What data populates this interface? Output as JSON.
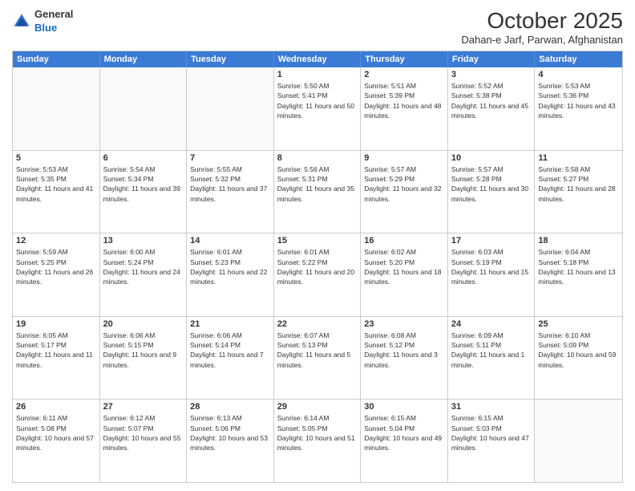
{
  "header": {
    "logo": {
      "general": "General",
      "blue": "Blue"
    },
    "month": "October 2025",
    "location": "Dahan-e Jarf, Parwan, Afghanistan"
  },
  "day_headers": [
    "Sunday",
    "Monday",
    "Tuesday",
    "Wednesday",
    "Thursday",
    "Friday",
    "Saturday"
  ],
  "weeks": [
    [
      {
        "day": "",
        "empty": true
      },
      {
        "day": "",
        "empty": true
      },
      {
        "day": "",
        "empty": true
      },
      {
        "day": "1",
        "sunrise": "Sunrise: 5:50 AM",
        "sunset": "Sunset: 5:41 PM",
        "daylight": "Daylight: 11 hours and 50 minutes."
      },
      {
        "day": "2",
        "sunrise": "Sunrise: 5:51 AM",
        "sunset": "Sunset: 5:39 PM",
        "daylight": "Daylight: 11 hours and 48 minutes."
      },
      {
        "day": "3",
        "sunrise": "Sunrise: 5:52 AM",
        "sunset": "Sunset: 5:38 PM",
        "daylight": "Daylight: 11 hours and 45 minutes."
      },
      {
        "day": "4",
        "sunrise": "Sunrise: 5:53 AM",
        "sunset": "Sunset: 5:36 PM",
        "daylight": "Daylight: 11 hours and 43 minutes."
      }
    ],
    [
      {
        "day": "5",
        "sunrise": "Sunrise: 5:53 AM",
        "sunset": "Sunset: 5:35 PM",
        "daylight": "Daylight: 11 hours and 41 minutes."
      },
      {
        "day": "6",
        "sunrise": "Sunrise: 5:54 AM",
        "sunset": "Sunset: 5:34 PM",
        "daylight": "Daylight: 11 hours and 39 minutes."
      },
      {
        "day": "7",
        "sunrise": "Sunrise: 5:55 AM",
        "sunset": "Sunset: 5:32 PM",
        "daylight": "Daylight: 11 hours and 37 minutes."
      },
      {
        "day": "8",
        "sunrise": "Sunrise: 5:56 AM",
        "sunset": "Sunset: 5:31 PM",
        "daylight": "Daylight: 11 hours and 35 minutes."
      },
      {
        "day": "9",
        "sunrise": "Sunrise: 5:57 AM",
        "sunset": "Sunset: 5:29 PM",
        "daylight": "Daylight: 11 hours and 32 minutes."
      },
      {
        "day": "10",
        "sunrise": "Sunrise: 5:57 AM",
        "sunset": "Sunset: 5:28 PM",
        "daylight": "Daylight: 11 hours and 30 minutes."
      },
      {
        "day": "11",
        "sunrise": "Sunrise: 5:58 AM",
        "sunset": "Sunset: 5:27 PM",
        "daylight": "Daylight: 11 hours and 28 minutes."
      }
    ],
    [
      {
        "day": "12",
        "sunrise": "Sunrise: 5:59 AM",
        "sunset": "Sunset: 5:25 PM",
        "daylight": "Daylight: 11 hours and 26 minutes."
      },
      {
        "day": "13",
        "sunrise": "Sunrise: 6:00 AM",
        "sunset": "Sunset: 5:24 PM",
        "daylight": "Daylight: 11 hours and 24 minutes."
      },
      {
        "day": "14",
        "sunrise": "Sunrise: 6:01 AM",
        "sunset": "Sunset: 5:23 PM",
        "daylight": "Daylight: 11 hours and 22 minutes."
      },
      {
        "day": "15",
        "sunrise": "Sunrise: 6:01 AM",
        "sunset": "Sunset: 5:22 PM",
        "daylight": "Daylight: 11 hours and 20 minutes."
      },
      {
        "day": "16",
        "sunrise": "Sunrise: 6:02 AM",
        "sunset": "Sunset: 5:20 PM",
        "daylight": "Daylight: 11 hours and 18 minutes."
      },
      {
        "day": "17",
        "sunrise": "Sunrise: 6:03 AM",
        "sunset": "Sunset: 5:19 PM",
        "daylight": "Daylight: 11 hours and 15 minutes."
      },
      {
        "day": "18",
        "sunrise": "Sunrise: 6:04 AM",
        "sunset": "Sunset: 5:18 PM",
        "daylight": "Daylight: 11 hours and 13 minutes."
      }
    ],
    [
      {
        "day": "19",
        "sunrise": "Sunrise: 6:05 AM",
        "sunset": "Sunset: 5:17 PM",
        "daylight": "Daylight: 11 hours and 11 minutes."
      },
      {
        "day": "20",
        "sunrise": "Sunrise: 6:06 AM",
        "sunset": "Sunset: 5:15 PM",
        "daylight": "Daylight: 11 hours and 9 minutes."
      },
      {
        "day": "21",
        "sunrise": "Sunrise: 6:06 AM",
        "sunset": "Sunset: 5:14 PM",
        "daylight": "Daylight: 11 hours and 7 minutes."
      },
      {
        "day": "22",
        "sunrise": "Sunrise: 6:07 AM",
        "sunset": "Sunset: 5:13 PM",
        "daylight": "Daylight: 11 hours and 5 minutes."
      },
      {
        "day": "23",
        "sunrise": "Sunrise: 6:08 AM",
        "sunset": "Sunset: 5:12 PM",
        "daylight": "Daylight: 11 hours and 3 minutes."
      },
      {
        "day": "24",
        "sunrise": "Sunrise: 6:09 AM",
        "sunset": "Sunset: 5:11 PM",
        "daylight": "Daylight: 11 hours and 1 minute."
      },
      {
        "day": "25",
        "sunrise": "Sunrise: 6:10 AM",
        "sunset": "Sunset: 5:09 PM",
        "daylight": "Daylight: 10 hours and 59 minutes."
      }
    ],
    [
      {
        "day": "26",
        "sunrise": "Sunrise: 6:11 AM",
        "sunset": "Sunset: 5:08 PM",
        "daylight": "Daylight: 10 hours and 57 minutes."
      },
      {
        "day": "27",
        "sunrise": "Sunrise: 6:12 AM",
        "sunset": "Sunset: 5:07 PM",
        "daylight": "Daylight: 10 hours and 55 minutes."
      },
      {
        "day": "28",
        "sunrise": "Sunrise: 6:13 AM",
        "sunset": "Sunset: 5:06 PM",
        "daylight": "Daylight: 10 hours and 53 minutes."
      },
      {
        "day": "29",
        "sunrise": "Sunrise: 6:14 AM",
        "sunset": "Sunset: 5:05 PM",
        "daylight": "Daylight: 10 hours and 51 minutes."
      },
      {
        "day": "30",
        "sunrise": "Sunrise: 6:15 AM",
        "sunset": "Sunset: 5:04 PM",
        "daylight": "Daylight: 10 hours and 49 minutes."
      },
      {
        "day": "31",
        "sunrise": "Sunrise: 6:15 AM",
        "sunset": "Sunset: 5:03 PM",
        "daylight": "Daylight: 10 hours and 47 minutes."
      },
      {
        "day": "",
        "empty": true
      }
    ]
  ]
}
